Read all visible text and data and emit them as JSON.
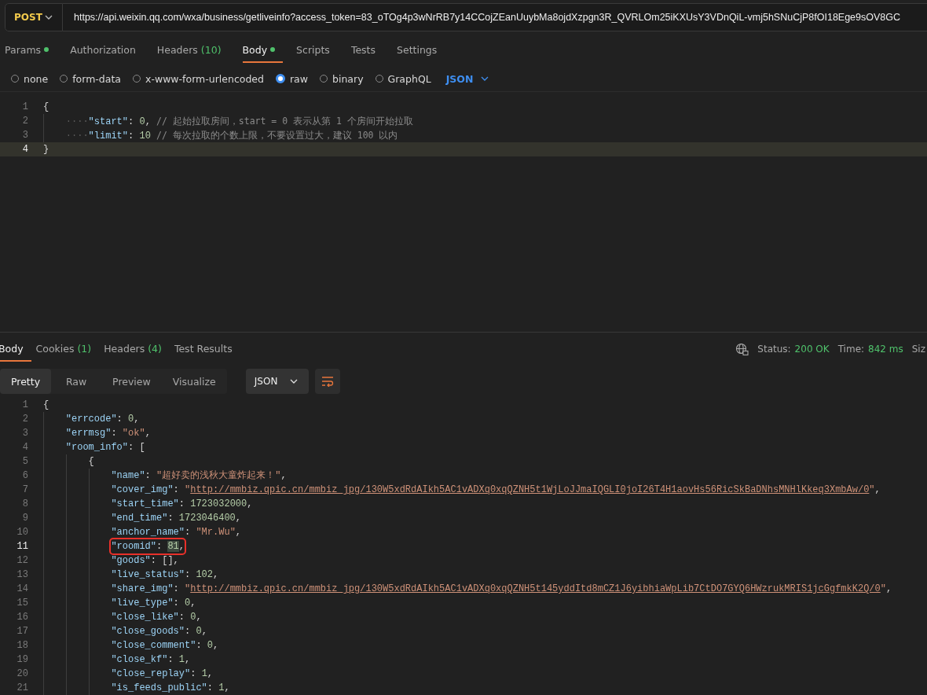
{
  "request": {
    "method": "POST",
    "url": "https://api.weixin.qq.com/wxa/business/getliveinfo?access_token=83_oTOg4p3wNrRB7y14CCojZEanUuybMa8ojdXzpgn3R_QVRLOm25iKXUsY3VDnQiL-vmj5hSNuCjP8fOI18Ege9sOV8GC"
  },
  "request_tabs": [
    {
      "label": "Params",
      "dot": true,
      "selected": false
    },
    {
      "label": "Authorization",
      "dot": false,
      "selected": false
    },
    {
      "label": "Headers",
      "count": "(10)",
      "dot": false,
      "selected": false
    },
    {
      "label": "Body",
      "dot": true,
      "selected": true
    },
    {
      "label": "Scripts",
      "dot": false,
      "selected": false
    },
    {
      "label": "Tests",
      "dot": false,
      "selected": false
    },
    {
      "label": "Settings",
      "dot": false,
      "selected": false
    }
  ],
  "body_types": [
    {
      "label": "none",
      "selected": false
    },
    {
      "label": "form-data",
      "selected": false
    },
    {
      "label": "x-www-form-urlencoded",
      "selected": false
    },
    {
      "label": "raw",
      "selected": true
    },
    {
      "label": "binary",
      "selected": false
    },
    {
      "label": "GraphQL",
      "selected": false
    }
  ],
  "raw_format": "JSON",
  "request_editor": {
    "focused": true,
    "lines": [
      {
        "number": "1",
        "current": false,
        "boxed": false,
        "tokens": [
          {
            "kind": "punct",
            "text": "{"
          }
        ],
        "children": [
          {
            "number": "2",
            "current": false,
            "boxed": false,
            "tokens": [
              {
                "kind": "ws",
                "text": "····"
              },
              {
                "kind": "key",
                "text": "\"start\""
              },
              {
                "kind": "punct",
                "text": ":"
              },
              {
                "kind": "num",
                "text": "0"
              },
              {
                "kind": "punct",
                "text": ","
              },
              {
                "kind": "comment",
                "text": "// 起始拉取房间，start = 0 表示从第 1 个房间开始拉取"
              }
            ]
          },
          {
            "number": "3",
            "current": false,
            "boxed": false,
            "tokens": [
              {
                "kind": "ws",
                "text": "····"
              },
              {
                "kind": "key",
                "text": "\"limit\""
              },
              {
                "kind": "punct",
                "text": ":"
              },
              {
                "kind": "num",
                "text": "10"
              },
              {
                "kind": "comment",
                "text": "// 每次拉取的个数上限，不要设置过大，建议 100 以内"
              }
            ]
          }
        ]
      },
      {
        "number": "4",
        "current": true,
        "boxed": false,
        "tokens": [
          {
            "kind": "punct",
            "text": "}"
          }
        ]
      }
    ]
  },
  "response_tabs": [
    {
      "label": "Body",
      "selected": true
    },
    {
      "label": "Cookies",
      "count": "(1)",
      "selected": false
    },
    {
      "label": "Headers",
      "count": "(4)",
      "selected": false
    },
    {
      "label": "Test Results",
      "selected": false
    }
  ],
  "status": {
    "status_label": "Status:",
    "status_value": "200 OK",
    "time_label": "Time:",
    "time_value": "842 ms",
    "size_label": "Siz"
  },
  "view_modes": [
    {
      "label": "Pretty",
      "selected": true
    },
    {
      "label": "Raw",
      "selected": false
    },
    {
      "label": "Preview",
      "selected": false
    },
    {
      "label": "Visualize",
      "selected": false
    }
  ],
  "response_format": "JSON",
  "response_editor": {
    "focused": false,
    "lines": [
      {
        "number": "1",
        "current": false,
        "boxed": false,
        "tokens": [
          {
            "kind": "punct",
            "text": "{"
          }
        ],
        "children": [
          {
            "number": "2",
            "current": false,
            "boxed": false,
            "tokens": [
              {
                "kind": "key",
                "text": "\"errcode\""
              },
              {
                "kind": "punct",
                "text": ":"
              },
              {
                "kind": "num",
                "text": "0"
              },
              {
                "kind": "punct",
                "text": ","
              }
            ]
          },
          {
            "number": "3",
            "current": false,
            "boxed": false,
            "tokens": [
              {
                "kind": "key",
                "text": "\"errmsg\""
              },
              {
                "kind": "punct",
                "text": ":"
              },
              {
                "kind": "str",
                "text": "\"ok\""
              },
              {
                "kind": "punct",
                "text": ","
              }
            ]
          },
          {
            "number": "4",
            "current": false,
            "boxed": false,
            "tokens": [
              {
                "kind": "key",
                "text": "\"room_info\""
              },
              {
                "kind": "punct",
                "text": ":"
              },
              {
                "kind": "punct",
                "text": "["
              }
            ],
            "children": [
              {
                "number": "5",
                "current": false,
                "boxed": false,
                "tokens": [
                  {
                    "kind": "punct",
                    "text": "{"
                  }
                ],
                "children": [
                  {
                    "number": "6",
                    "current": false,
                    "boxed": false,
                    "tokens": [
                      {
                        "kind": "key",
                        "text": "\"name\""
                      },
                      {
                        "kind": "punct",
                        "text": ":"
                      },
                      {
                        "kind": "str",
                        "text": "\"超好卖的浅秋大童炸起来！\""
                      },
                      {
                        "kind": "punct",
                        "text": ","
                      }
                    ]
                  },
                  {
                    "number": "7",
                    "current": false,
                    "boxed": false,
                    "tokens": [
                      {
                        "kind": "key",
                        "text": "\"cover_img\""
                      },
                      {
                        "kind": "punct",
                        "text": ":"
                      },
                      {
                        "kind": "str",
                        "text": "\""
                      },
                      {
                        "kind": "link",
                        "text": "http://mmbiz.qpic.cn/mmbiz_jpg/130W5xdRdAIkh5AC1vADXq0xqQZNH5t1WjLoJJmaIQGLI0joI26T4H1aovHs56RicSkBaDNhsMNHlKkeq3XmbAw/0"
                      },
                      {
                        "kind": "str",
                        "text": "\""
                      },
                      {
                        "kind": "punct",
                        "text": ","
                      }
                    ]
                  },
                  {
                    "number": "8",
                    "current": false,
                    "boxed": false,
                    "tokens": [
                      {
                        "kind": "key",
                        "text": "\"start_time\""
                      },
                      {
                        "kind": "punct",
                        "text": ":"
                      },
                      {
                        "kind": "num",
                        "text": "1723032000"
                      },
                      {
                        "kind": "punct",
                        "text": ","
                      }
                    ]
                  },
                  {
                    "number": "9",
                    "current": false,
                    "boxed": false,
                    "tokens": [
                      {
                        "kind": "key",
                        "text": "\"end_time\""
                      },
                      {
                        "kind": "punct",
                        "text": ":"
                      },
                      {
                        "kind": "num",
                        "text": "1723046400"
                      },
                      {
                        "kind": "punct",
                        "text": ","
                      }
                    ]
                  },
                  {
                    "number": "10",
                    "current": false,
                    "boxed": false,
                    "tokens": [
                      {
                        "kind": "key",
                        "text": "\"anchor_name\""
                      },
                      {
                        "kind": "punct",
                        "text": ":"
                      },
                      {
                        "kind": "str",
                        "text": "\"Mr.Wu\""
                      },
                      {
                        "kind": "punct",
                        "text": ","
                      }
                    ]
                  },
                  {
                    "number": "11",
                    "current": true,
                    "boxed": true,
                    "tokens": [
                      {
                        "kind": "key",
                        "text": "\"roomid\""
                      },
                      {
                        "kind": "punct",
                        "text": ":"
                      },
                      {
                        "kind": "num",
                        "text": "81",
                        "selected": true
                      },
                      {
                        "kind": "punct",
                        "text": ","
                      }
                    ]
                  },
                  {
                    "number": "12",
                    "current": false,
                    "boxed": false,
                    "tokens": [
                      {
                        "kind": "key",
                        "text": "\"goods\""
                      },
                      {
                        "kind": "punct",
                        "text": ":"
                      },
                      {
                        "kind": "punct",
                        "text": "[],"
                      }
                    ]
                  },
                  {
                    "number": "13",
                    "current": false,
                    "boxed": false,
                    "tokens": [
                      {
                        "kind": "key",
                        "text": "\"live_status\""
                      },
                      {
                        "kind": "punct",
                        "text": ":"
                      },
                      {
                        "kind": "num",
                        "text": "102"
                      },
                      {
                        "kind": "punct",
                        "text": ","
                      }
                    ]
                  },
                  {
                    "number": "14",
                    "current": false,
                    "boxed": false,
                    "tokens": [
                      {
                        "kind": "key",
                        "text": "\"share_img\""
                      },
                      {
                        "kind": "punct",
                        "text": ":"
                      },
                      {
                        "kind": "str",
                        "text": "\""
                      },
                      {
                        "kind": "link",
                        "text": "http://mmbiz.qpic.cn/mmbiz_jpg/130W5xdRdAIkh5AC1vADXq0xqQZNH5t145yddItd8mCZ1J6yibhiaWpLib7CtDO7GYQ6HWzrukMRIS1jcGgfmkK2Q/0"
                      },
                      {
                        "kind": "str",
                        "text": "\""
                      },
                      {
                        "kind": "punct",
                        "text": ","
                      }
                    ]
                  },
                  {
                    "number": "15",
                    "current": false,
                    "boxed": false,
                    "tokens": [
                      {
                        "kind": "key",
                        "text": "\"live_type\""
                      },
                      {
                        "kind": "punct",
                        "text": ":"
                      },
                      {
                        "kind": "num",
                        "text": "0"
                      },
                      {
                        "kind": "punct",
                        "text": ","
                      }
                    ]
                  },
                  {
                    "number": "16",
                    "current": false,
                    "boxed": false,
                    "tokens": [
                      {
                        "kind": "key",
                        "text": "\"close_like\""
                      },
                      {
                        "kind": "punct",
                        "text": ":"
                      },
                      {
                        "kind": "num",
                        "text": "0"
                      },
                      {
                        "kind": "punct",
                        "text": ","
                      }
                    ]
                  },
                  {
                    "number": "17",
                    "current": false,
                    "boxed": false,
                    "tokens": [
                      {
                        "kind": "key",
                        "text": "\"close_goods\""
                      },
                      {
                        "kind": "punct",
                        "text": ":"
                      },
                      {
                        "kind": "num",
                        "text": "0"
                      },
                      {
                        "kind": "punct",
                        "text": ","
                      }
                    ]
                  },
                  {
                    "number": "18",
                    "current": false,
                    "boxed": false,
                    "tokens": [
                      {
                        "kind": "key",
                        "text": "\"close_comment\""
                      },
                      {
                        "kind": "punct",
                        "text": ":"
                      },
                      {
                        "kind": "num",
                        "text": "0"
                      },
                      {
                        "kind": "punct",
                        "text": ","
                      }
                    ]
                  },
                  {
                    "number": "19",
                    "current": false,
                    "boxed": false,
                    "tokens": [
                      {
                        "kind": "key",
                        "text": "\"close_kf\""
                      },
                      {
                        "kind": "punct",
                        "text": ":"
                      },
                      {
                        "kind": "num",
                        "text": "1"
                      },
                      {
                        "kind": "punct",
                        "text": ","
                      }
                    ]
                  },
                  {
                    "number": "20",
                    "current": false,
                    "boxed": false,
                    "tokens": [
                      {
                        "kind": "key",
                        "text": "\"close_replay\""
                      },
                      {
                        "kind": "punct",
                        "text": ":"
                      },
                      {
                        "kind": "num",
                        "text": "1"
                      },
                      {
                        "kind": "punct",
                        "text": ","
                      }
                    ]
                  },
                  {
                    "number": "21",
                    "current": false,
                    "boxed": false,
                    "tokens": [
                      {
                        "kind": "key",
                        "text": "\"is_feeds_public\""
                      },
                      {
                        "kind": "punct",
                        "text": ":"
                      },
                      {
                        "kind": "num",
                        "text": "1"
                      },
                      {
                        "kind": "punct",
                        "text": ","
                      }
                    ]
                  }
                ]
              }
            ]
          }
        ]
      }
    ]
  }
}
